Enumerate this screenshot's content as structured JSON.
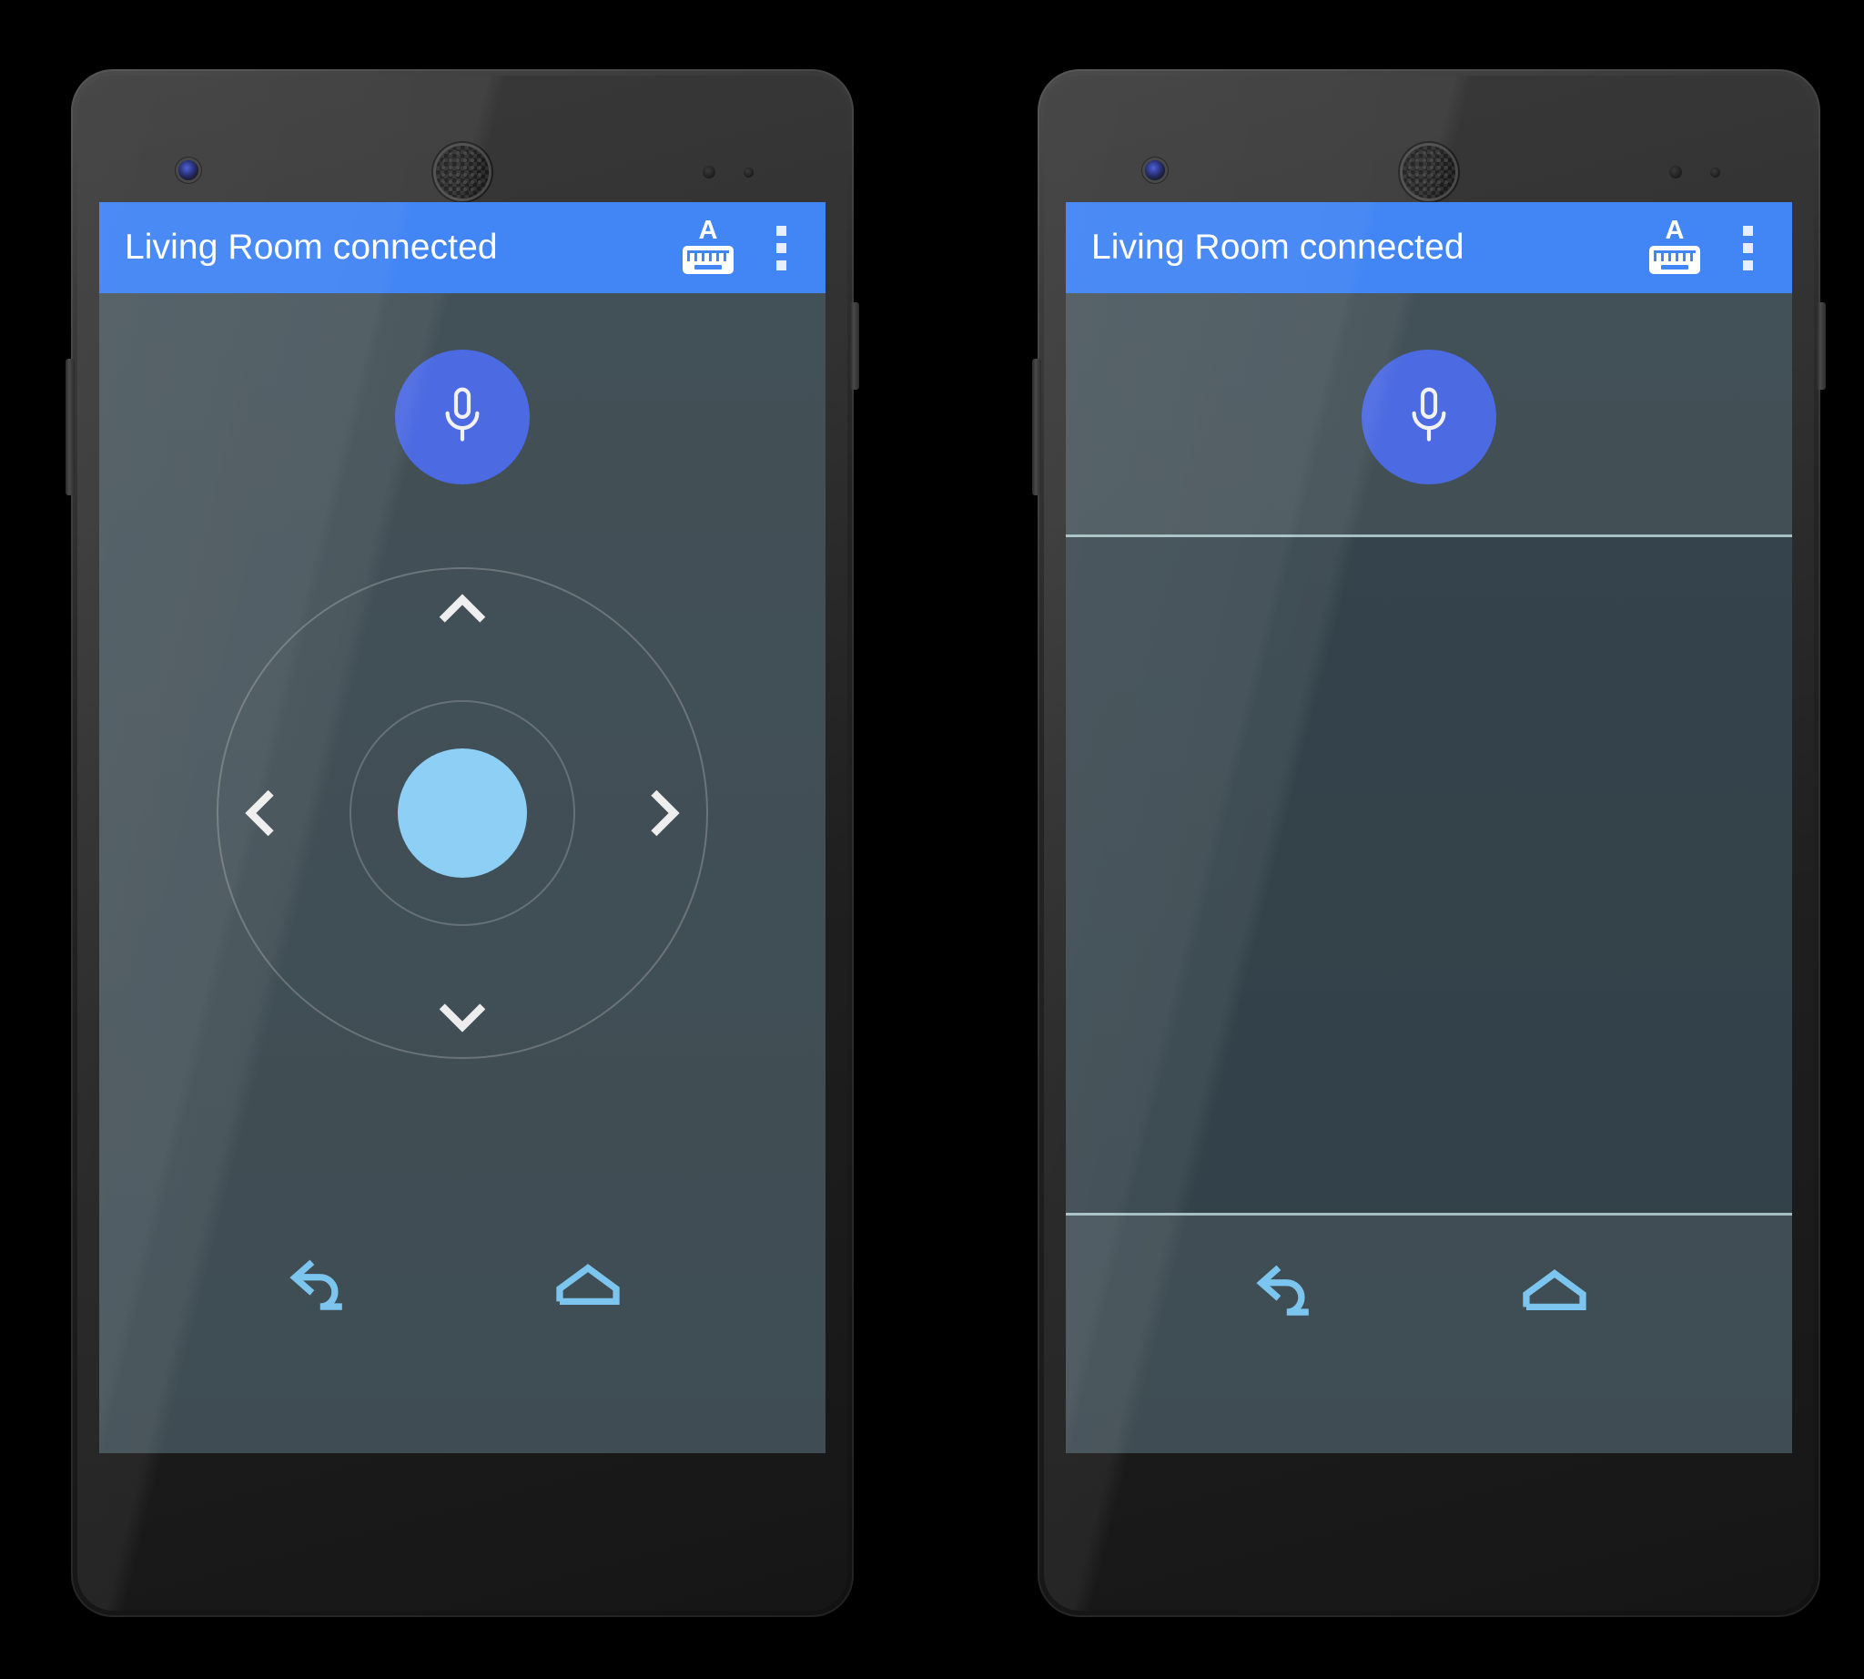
{
  "page": {
    "title": "Android TV Remote app — two phone screens",
    "background_color": "#000000"
  },
  "theme": {
    "appbar_blue": "#4285f4",
    "screen_background": "#404e55",
    "panel_dark": "#33424a",
    "mic_button_blue": "#4a69e2",
    "select_button_blue": "#8ed1f7",
    "nav_icon_blue": "#8ed1f7",
    "divider_color": "#b9d2d6",
    "ring_color": "rgba(255,255,255,0.22)"
  },
  "devices": [
    {
      "id": "phone-left",
      "label": "Phone with D-pad remote",
      "appbar": {
        "title": "Living Room connected",
        "actions": [
          {
            "name": "keyboard-button",
            "icon": "keyboard-icon",
            "label": "Keyboard"
          },
          {
            "name": "overflow-button",
            "icon": "more-vert-icon",
            "label": "More options"
          }
        ]
      },
      "mic": {
        "icon": "microphone-icon",
        "label": "Voice search"
      },
      "dpad": {
        "up": {
          "icon": "chevron-up-icon",
          "label": "Up"
        },
        "down": {
          "icon": "chevron-down-icon",
          "label": "Down"
        },
        "left": {
          "icon": "chevron-left-icon",
          "label": "Left"
        },
        "right": {
          "icon": "chevron-right-icon",
          "label": "Right"
        },
        "select": {
          "icon": "select-circle-icon",
          "label": "Select"
        }
      },
      "nav": [
        {
          "name": "back-button",
          "icon": "back-arrow-icon",
          "label": "Back"
        },
        {
          "name": "home-button",
          "icon": "home-icon",
          "label": "Home"
        }
      ],
      "has_dpad": true
    },
    {
      "id": "phone-right",
      "label": "Phone with touchpad remote",
      "appbar": {
        "title": "Living Room connected",
        "actions": [
          {
            "name": "keyboard-button",
            "icon": "keyboard-icon",
            "label": "Keyboard"
          },
          {
            "name": "overflow-button",
            "icon": "more-vert-icon",
            "label": "More options"
          }
        ]
      },
      "mic": {
        "icon": "microphone-icon",
        "label": "Voice search"
      },
      "touchpad": {
        "name": "touchpad-area",
        "label": "Touchpad"
      },
      "nav": [
        {
          "name": "back-button",
          "icon": "back-arrow-icon",
          "label": "Back"
        },
        {
          "name": "home-button",
          "icon": "home-icon",
          "label": "Home"
        }
      ],
      "has_dpad": false
    }
  ]
}
